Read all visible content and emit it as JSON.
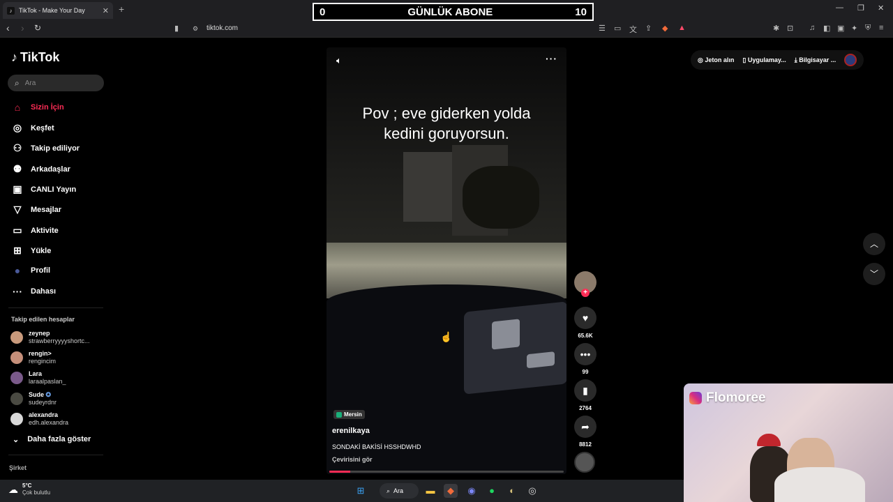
{
  "browser": {
    "tab_title": "TikTok - Make Your Day",
    "url": "tiktok.com"
  },
  "overlay": {
    "left_value": "0",
    "title": "GÜNLÜK ABONE",
    "right_value": "10"
  },
  "sidebar": {
    "logo_text": "TikTok",
    "search_placeholder": "Ara",
    "nav": [
      {
        "label": "Sizin İçin",
        "icon": "home-icon"
      },
      {
        "label": "Keşfet",
        "icon": "compass-icon"
      },
      {
        "label": "Takip ediliyor",
        "icon": "following-icon"
      },
      {
        "label": "Arkadaşlar",
        "icon": "friends-icon"
      },
      {
        "label": "CANLI Yayın",
        "icon": "live-icon"
      },
      {
        "label": "Mesajlar",
        "icon": "messages-icon"
      },
      {
        "label": "Aktivite",
        "icon": "activity-icon"
      },
      {
        "label": "Yükle",
        "icon": "upload-icon"
      },
      {
        "label": "Profil",
        "icon": "profile-icon"
      },
      {
        "label": "Dahası",
        "icon": "more-icon"
      }
    ],
    "following_title": "Takip edilen hesaplar",
    "following": [
      {
        "name": "zeynep",
        "handle": "strawberryyyyshortc...",
        "avatar_color": "#c99a7c"
      },
      {
        "name": "rengin>",
        "handle": "rengincim",
        "avatar_color": "#c58f7a"
      },
      {
        "name": "Lara",
        "handle": "laraalpaslan_",
        "avatar_color": "#7a5a8a"
      },
      {
        "name": "Sude",
        "handle": "sudeyrdnr",
        "avatar_color": "#4a4a42"
      },
      {
        "name": "alexandra",
        "handle": "edh.alexandra",
        "avatar_color": "#d9d9d9"
      }
    ],
    "show_more": "Daha fazla göster",
    "company_title": "Şirket"
  },
  "video": {
    "caption_line1": "Pov ; eve giderken yolda",
    "caption_line2": "kedini goruyorsun.",
    "location": "Mersin",
    "author": "erenilkaya",
    "description": "SONDAKİ BAKİSİ HSSHDWHD",
    "translate": "Çevirisini gör",
    "progress": 0.09
  },
  "actions": {
    "likes": "65.6K",
    "comments": "99",
    "saves": "2764",
    "shares": "8812"
  },
  "top_right": {
    "coins": "Jeton alın",
    "app": "Uygulamay...",
    "desktop": "Bilgisayar ..."
  },
  "webcam": {
    "name": "Flomoree"
  },
  "taskbar": {
    "temperature": "5°C",
    "weather_desc": "Çok bulutlu",
    "search_label": "Ara"
  },
  "colors": {
    "accent": "#fe2c55",
    "background": "#000000"
  }
}
